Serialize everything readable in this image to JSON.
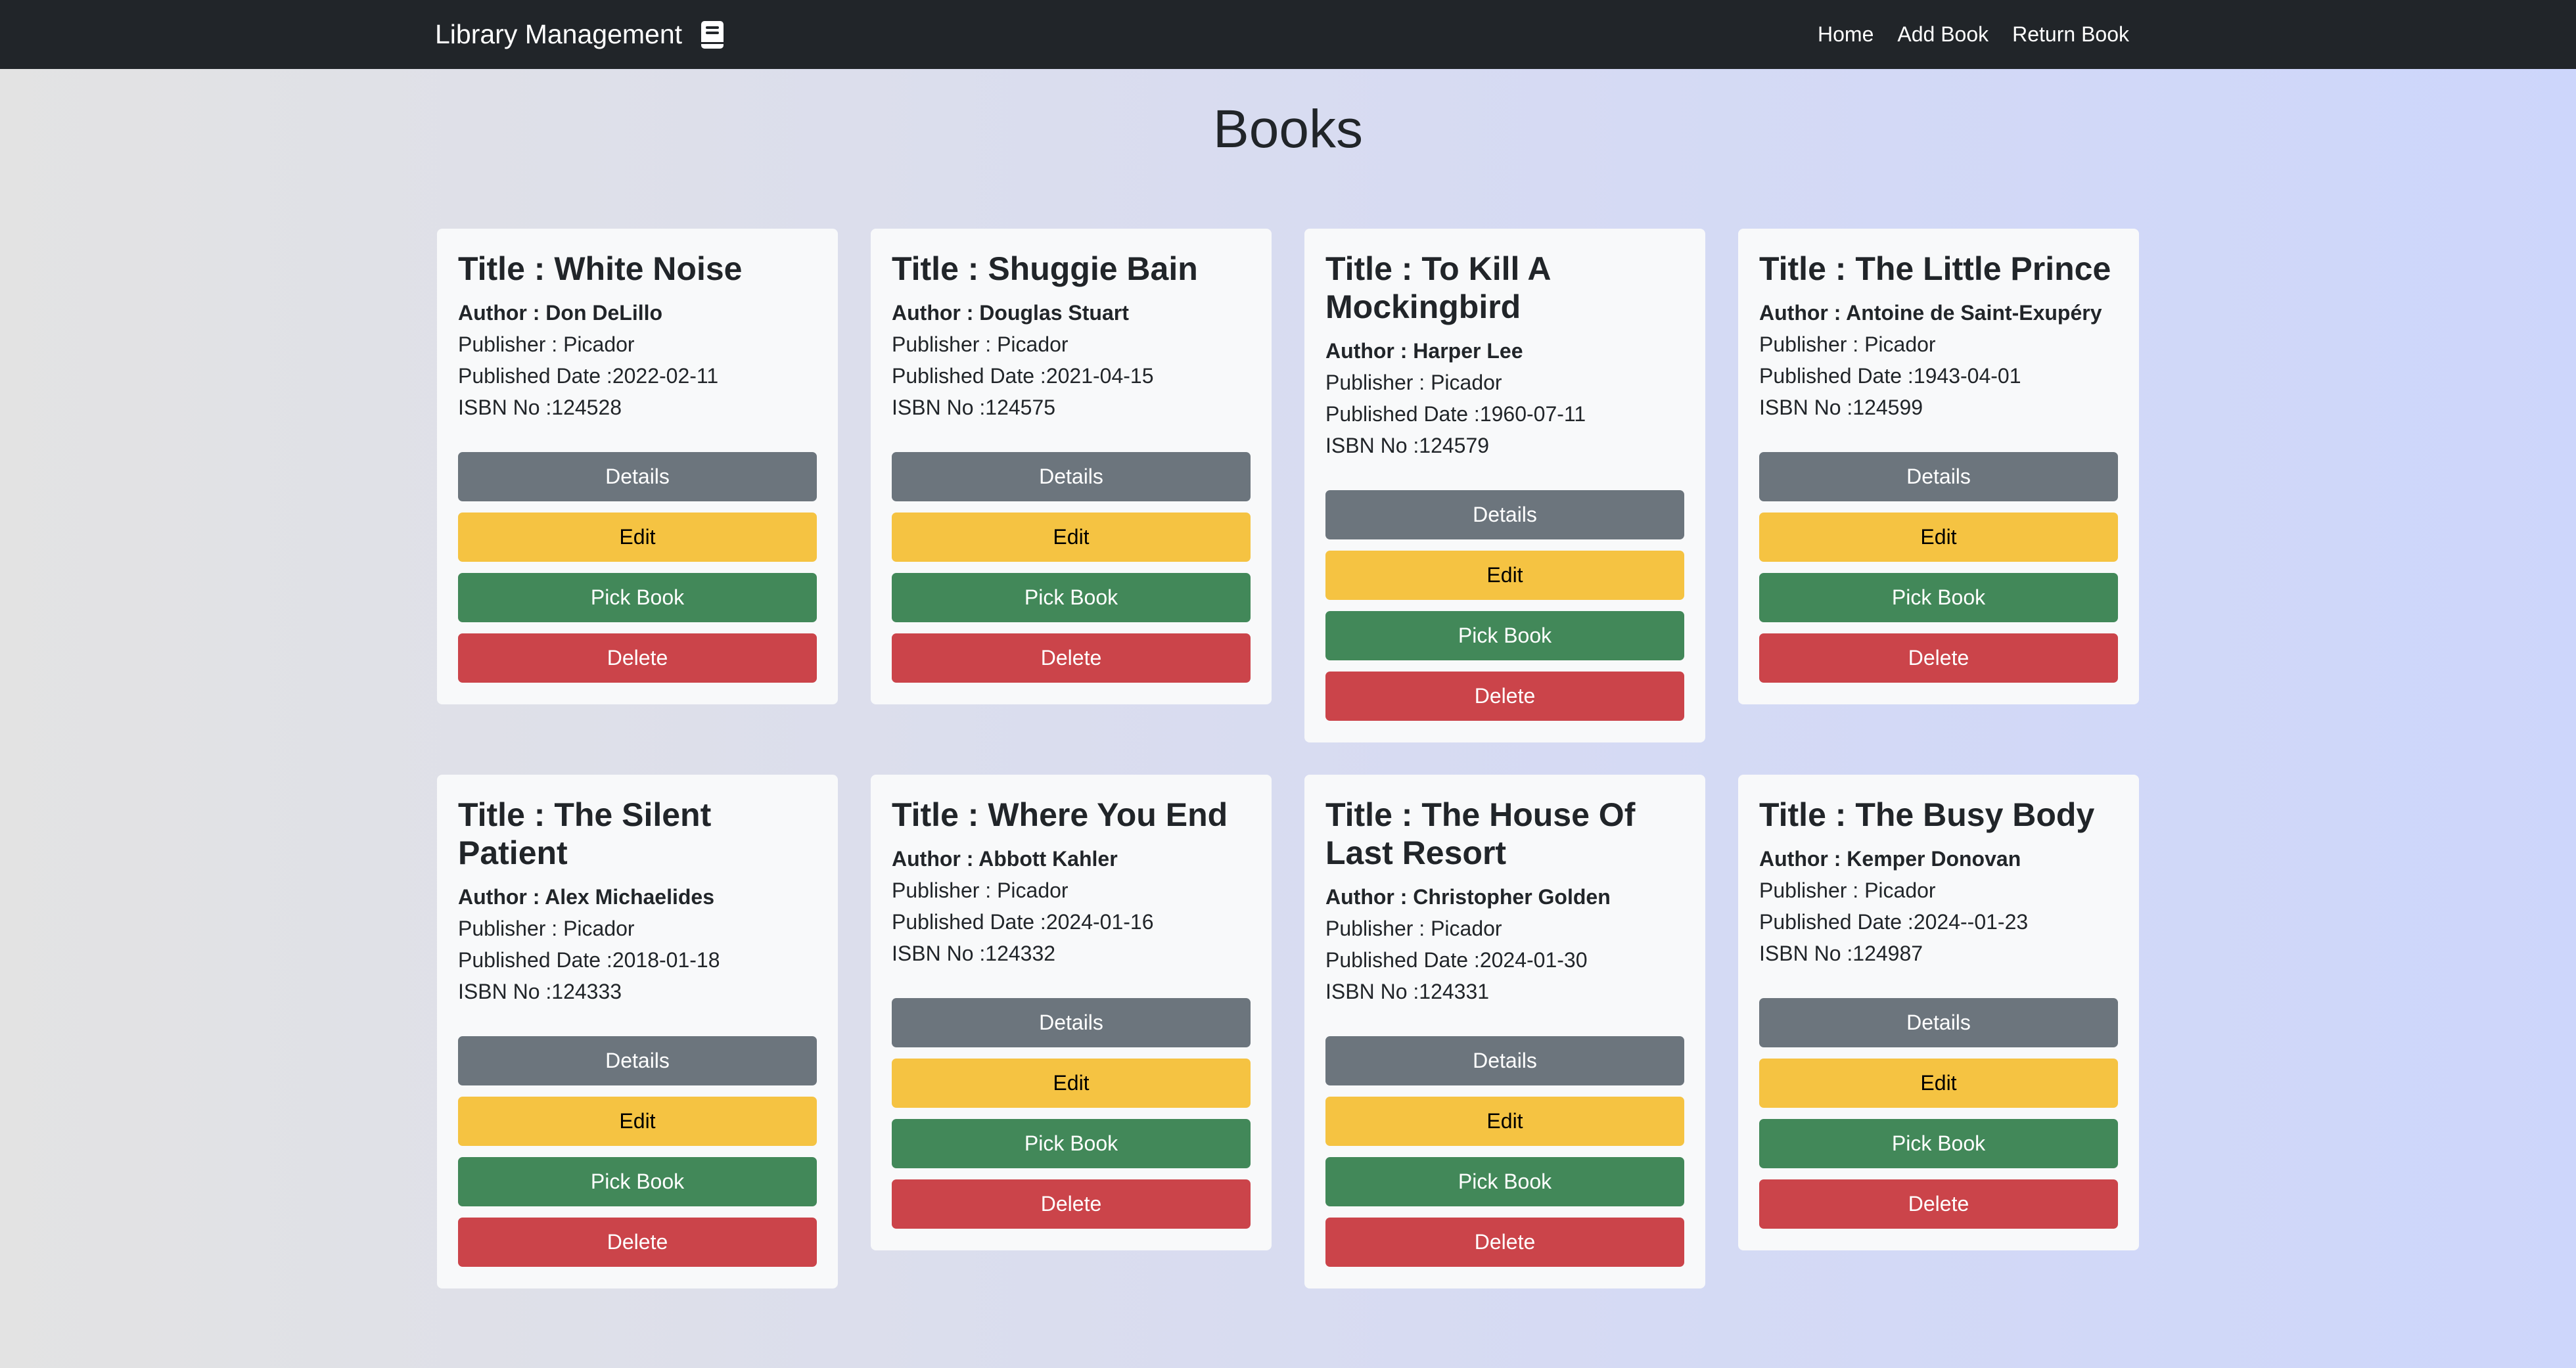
{
  "navbar": {
    "brand": "Library Management",
    "brand_icon": "book-icon",
    "links": [
      "Home",
      "Add Book",
      "Return Book"
    ]
  },
  "page": {
    "title": "Books"
  },
  "labels": {
    "title_prefix": "Title : ",
    "author_prefix": "Author : ",
    "publisher_prefix": "Publisher : ",
    "date_prefix": "Published Date :",
    "isbn_prefix": "ISBN No :"
  },
  "buttons": {
    "details": "Details",
    "edit": "Edit",
    "pick": "Pick Book",
    "delete": "Delete"
  },
  "colors": {
    "details": "#6c757d",
    "edit": "#f5c342",
    "pick": "#428859",
    "delete": "#cb444a",
    "navbar": "#212529"
  },
  "books": [
    {
      "title": "White Noise",
      "author": "Don DeLillo",
      "publisher": "Picador",
      "date": "2022-02-11",
      "isbn": "124528"
    },
    {
      "title": "Shuggie Bain",
      "author": "Douglas Stuart",
      "publisher": "Picador",
      "date": "2021-04-15",
      "isbn": "124575"
    },
    {
      "title": "To Kill A Mockingbird",
      "author": "Harper Lee",
      "publisher": "Picador",
      "date": "1960-07-11",
      "isbn": "124579"
    },
    {
      "title": "The Little Prince",
      "author": "Antoine de Saint-Exupéry",
      "publisher": "Picador",
      "date": "1943-04-01",
      "isbn": "124599"
    },
    {
      "title": "The Silent Patient",
      "author": "Alex Michaelides",
      "publisher": "Picador",
      "date": "2018-01-18",
      "isbn": "124333"
    },
    {
      "title": "Where You End",
      "author": "Abbott Kahler",
      "publisher": "Picador",
      "date": "2024-01-16",
      "isbn": "124332"
    },
    {
      "title": "The House Of Last Resort",
      "author": "Christopher Golden",
      "publisher": "Picador",
      "date": "2024-01-30",
      "isbn": "124331"
    },
    {
      "title": "The Busy Body",
      "author": "Kemper Donovan",
      "publisher": "Picador",
      "date": "2024--01-23",
      "isbn": "124987"
    }
  ]
}
